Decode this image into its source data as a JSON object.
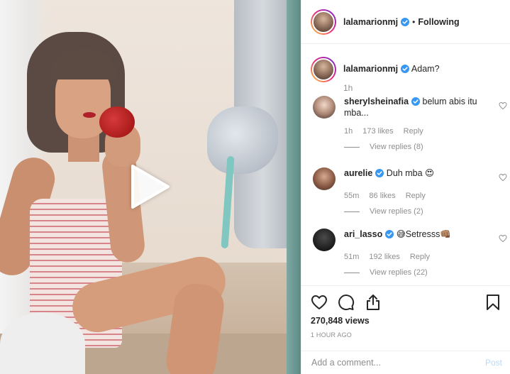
{
  "post": {
    "author": "lalamarionmj",
    "follow_status": "Following",
    "separator": "•",
    "caption": "Adam?",
    "caption_time": "1h",
    "view_count": "270,848 views",
    "posted_ago": "1 HOUR AGO"
  },
  "comments": [
    {
      "username": "sherylsheinafia",
      "text_line1": "belum abis itu",
      "text_line2": "mba...",
      "time": "1h",
      "likes": "173 likes",
      "reply_label": "Reply",
      "view_replies": "View replies (8)"
    },
    {
      "username": "aurelie",
      "text_line1": "Duh mba 😍",
      "time": "55m",
      "likes": "86 likes",
      "reply_label": "Reply",
      "view_replies": "View replies (2)"
    },
    {
      "username": "ari_lasso",
      "text_line1": "😅Setresss👊🏽",
      "time": "51m",
      "likes": "192 likes",
      "reply_label": "Reply",
      "view_replies": "View replies (22)"
    }
  ],
  "add_comment": {
    "placeholder": "Add a comment...",
    "post_label": "Post"
  },
  "icons": {
    "like": "heart-icon",
    "comment": "comment-icon",
    "share": "share-icon",
    "save": "bookmark-icon",
    "play": "play-icon",
    "verified": "verified-badge-icon"
  },
  "colors": {
    "verified_blue": "#3897f0",
    "post_disabled": "#b3dbff",
    "muted_text": "#8e8e8e"
  }
}
